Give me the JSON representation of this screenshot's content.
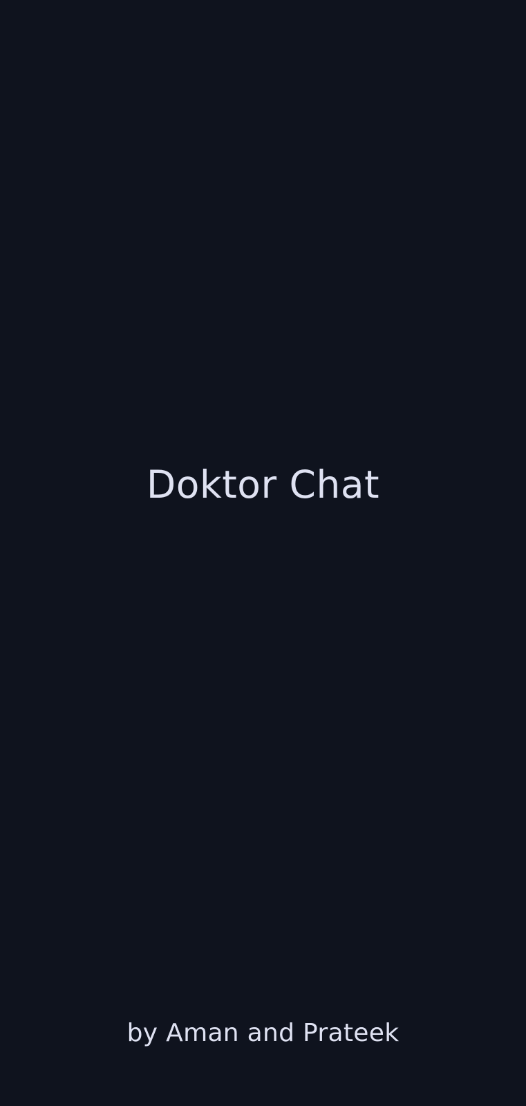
{
  "splash": {
    "title": "Doktor Chat",
    "credits": "by Aman and Prateek"
  },
  "colors": {
    "background": "#0f131e",
    "text": "#dfe2f2"
  }
}
